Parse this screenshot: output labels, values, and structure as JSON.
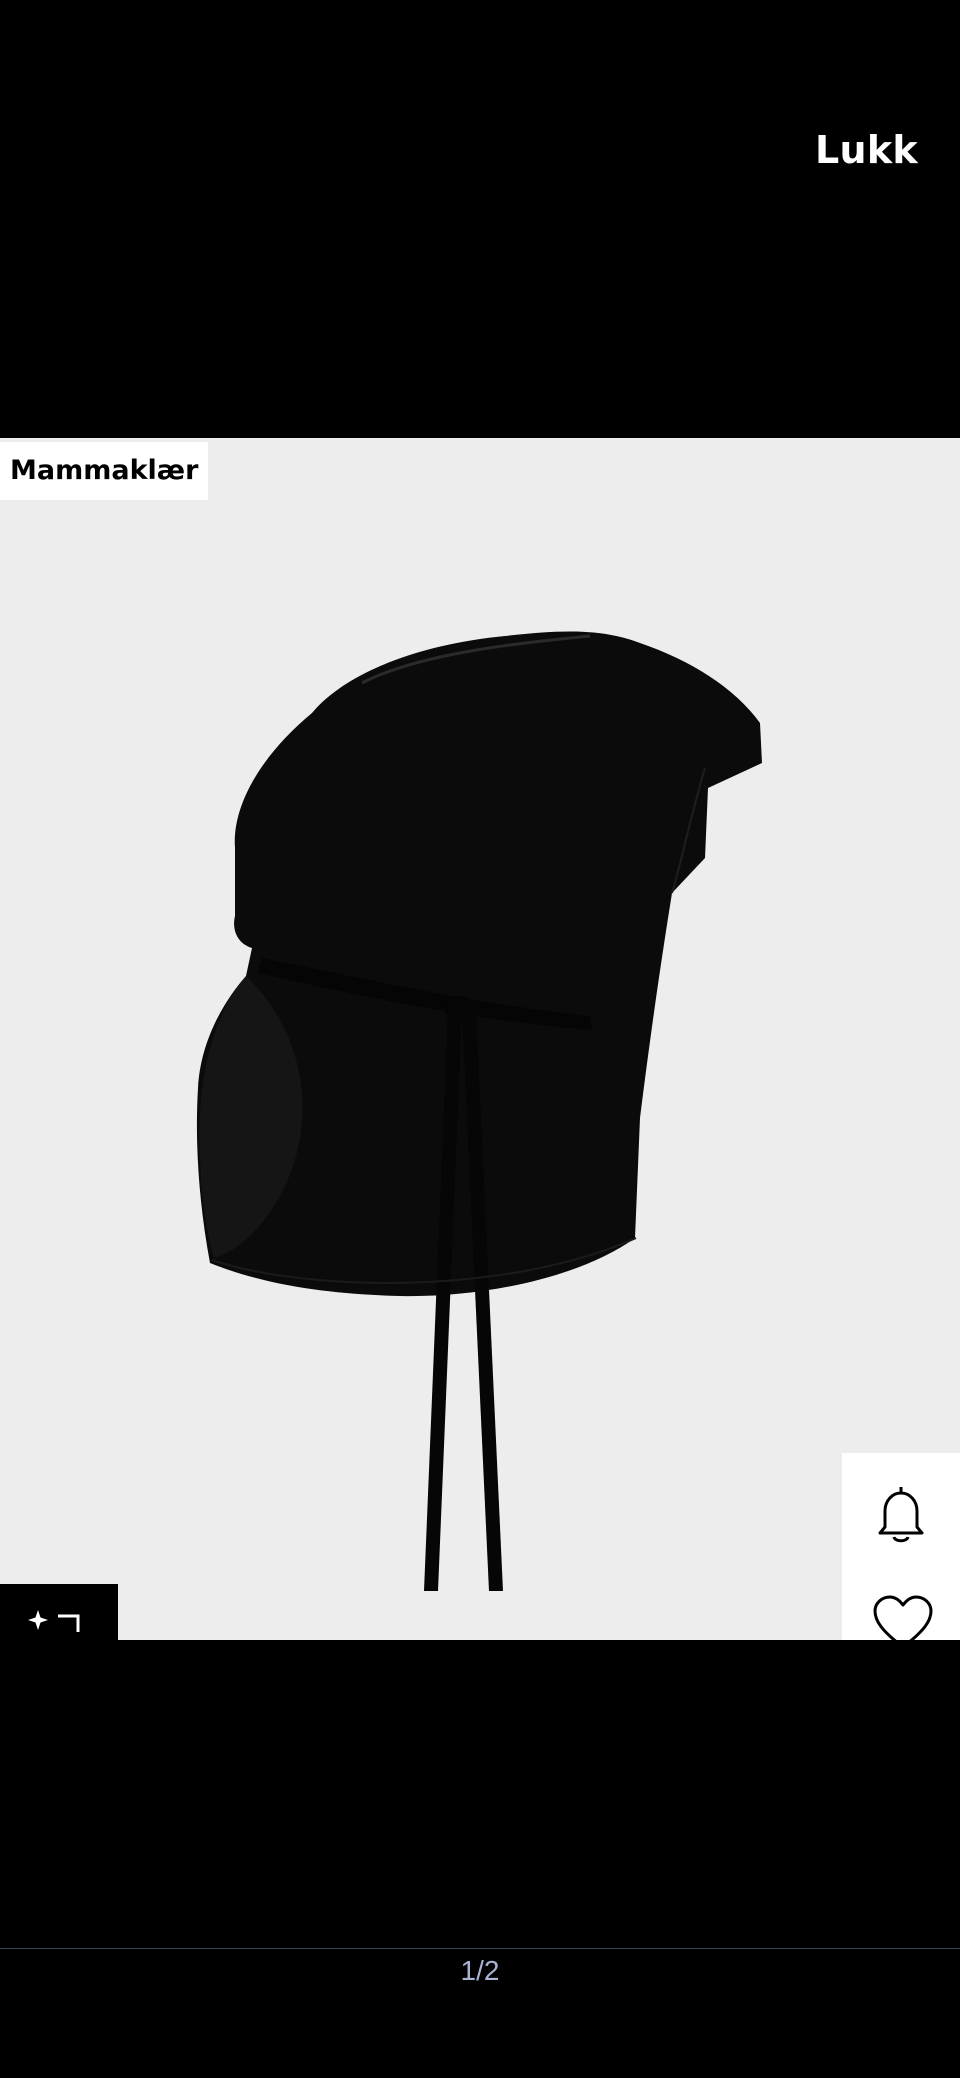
{
  "header": {
    "close_label": "Lukk"
  },
  "product": {
    "badge_label": "Mammaklær",
    "image_icon": "maternity-shirt-black"
  },
  "actions": {
    "stylehelp_icon": "sparkle-crop-icon",
    "notify_icon": "bell-icon",
    "wishlist_icon": "heart-icon"
  },
  "pager": {
    "label": "1/2"
  },
  "colors": {
    "background": "#000000",
    "image_background": "#ededed",
    "garment": "#0b0b0b",
    "pager_text": "#a9b3d3"
  }
}
